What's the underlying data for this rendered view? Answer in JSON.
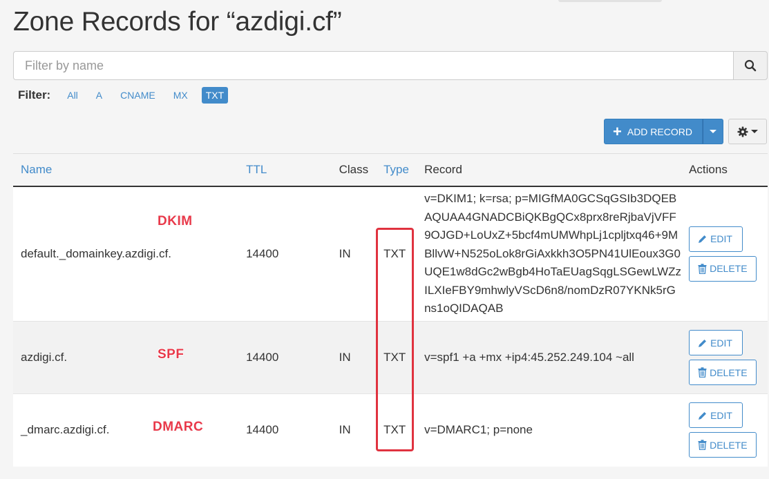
{
  "page": {
    "title": "Zone Records for “azdigi.cf”"
  },
  "search": {
    "placeholder": "Filter by name"
  },
  "filter": {
    "label": "Filter:",
    "options": [
      "All",
      "A",
      "CNAME",
      "MX",
      "TXT"
    ],
    "active": "TXT"
  },
  "toolbar": {
    "add_label": "ADD RECORD"
  },
  "table": {
    "headers": {
      "name": "Name",
      "ttl": "TTL",
      "class": "Class",
      "type": "Type",
      "record": "Record",
      "actions": "Actions"
    },
    "rows": [
      {
        "name": "default._domainkey.azdigi.cf.",
        "ttl": "14400",
        "class": "IN",
        "type": "TXT",
        "record": "v=DKIM1; k=rsa; p=MIGfMA0GCSqGSIb3DQEBAQUAA4GNADCBiQKBgQCx8prx8reRjbaVjVFF9OJGD+LoUxZ+5bcf4mUMWhpLj1cpljtxq46+9MBllvW+N525oLok8rGiAxkkh3O5PN41UlEoux3G0UQE1w8dGc2wBgb4HoTaEUagSqgLSGewLWZzILXIeFBY9mhwlyVScD6n8/nomDzR07YKNk5rGns1oQIDAQAB",
        "annotation": "DKIM"
      },
      {
        "name": "azdigi.cf.",
        "ttl": "14400",
        "class": "IN",
        "type": "TXT",
        "record": "v=spf1 +a +mx +ip4:45.252.249.104 ~all",
        "annotation": "SPF"
      },
      {
        "name": "_dmarc.azdigi.cf.",
        "ttl": "14400",
        "class": "IN",
        "type": "TXT",
        "record": "v=DMARC1; p=none",
        "annotation": "DMARC"
      }
    ],
    "edit_label": "EDIT",
    "delete_label": "DELETE"
  },
  "icons": {
    "search": "search-icon",
    "plus": "plus-icon",
    "gear": "gear-icon",
    "edit": "pencil-icon",
    "delete": "trash-icon"
  },
  "colors": {
    "primary": "#428bca",
    "annotation": "#e8394a",
    "highlight": "#e0323f"
  }
}
